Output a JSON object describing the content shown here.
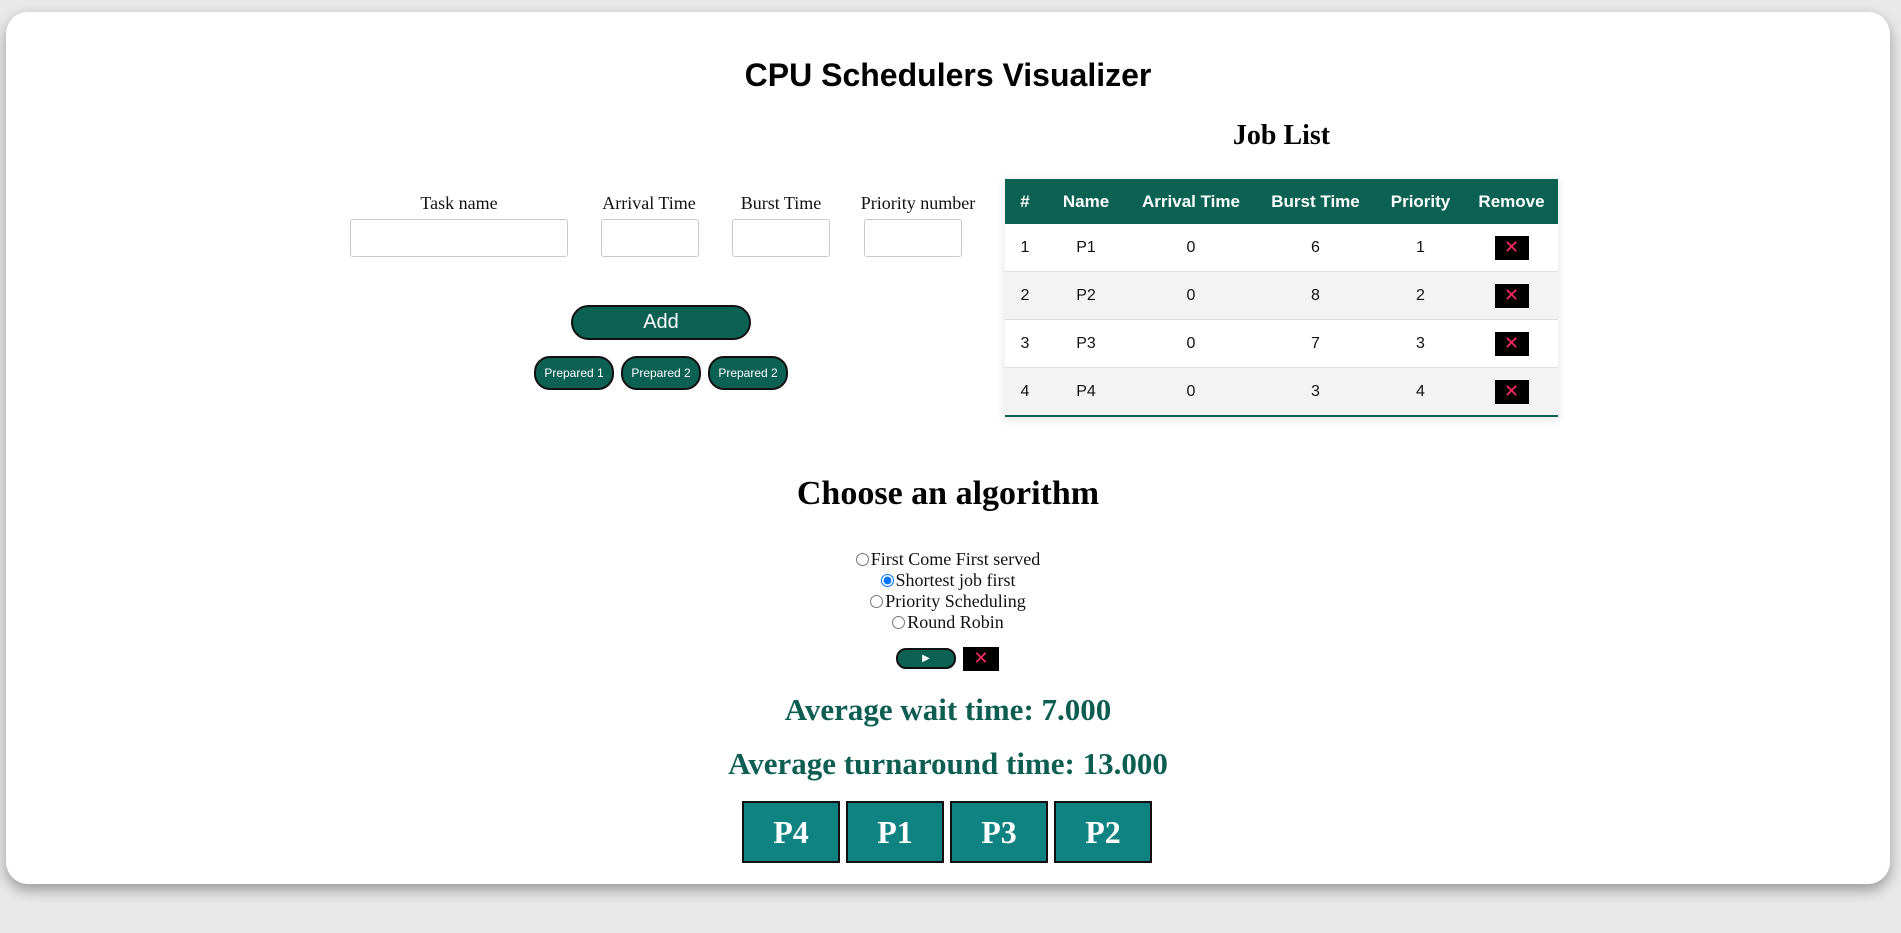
{
  "header": {
    "title": "CPU Schedulers Visualizer"
  },
  "form": {
    "task_name_label": "Task name",
    "arrival_time_label": "Arrival Time",
    "burst_time_label": "Burst Time",
    "priority_label": "Priority number",
    "task_name_value": "",
    "arrival_time_value": "",
    "burst_time_value": "",
    "priority_value": "",
    "add_label": "Add",
    "prepared": [
      "Prepared 1",
      "Prepared 2",
      "Prepared 2"
    ]
  },
  "job_list": {
    "title": "Job List",
    "columns": [
      "#",
      "Name",
      "Arrival Time",
      "Burst Time",
      "Priority",
      "Remove"
    ],
    "rows": [
      {
        "index": "1",
        "name": "P1",
        "arrival": "0",
        "burst": "6",
        "priority": "1"
      },
      {
        "index": "2",
        "name": "P2",
        "arrival": "0",
        "burst": "8",
        "priority": "2"
      },
      {
        "index": "3",
        "name": "P3",
        "arrival": "0",
        "burst": "7",
        "priority": "3"
      },
      {
        "index": "4",
        "name": "P4",
        "arrival": "0",
        "burst": "3",
        "priority": "4"
      }
    ],
    "remove_glyph": "✕"
  },
  "algorithm": {
    "title": "Choose an algorithm",
    "options": [
      {
        "label": "First Come First served",
        "selected": false
      },
      {
        "label": "Shortest job first",
        "selected": true
      },
      {
        "label": "Priority Scheduling",
        "selected": false
      },
      {
        "label": "Round Robin",
        "selected": false
      }
    ],
    "run_glyph": "▶",
    "clear_glyph": "✕"
  },
  "results": {
    "avg_wait": "Average wait time: 7.000",
    "avg_turnaround": "Average turnaround time: 13.000",
    "gantt": [
      "P4",
      "P1",
      "P3",
      "P2"
    ]
  },
  "colors": {
    "primary": "#0b6152",
    "gantt_block": "#0e8382",
    "remove_x": "#ff2a5d",
    "stat_text": "#0d5e52"
  }
}
